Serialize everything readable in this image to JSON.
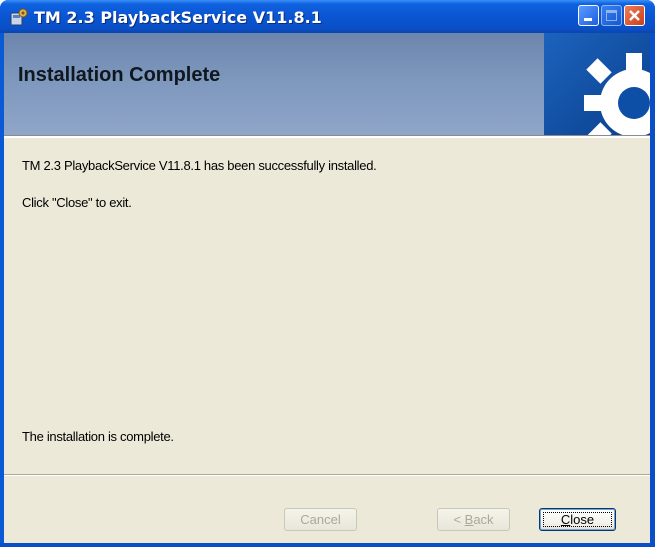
{
  "window": {
    "title": "TM 2.3 PlaybackService V11.8.1",
    "icon": "installer-icon",
    "controls": [
      "minimize-icon",
      "maximize-icon",
      "close-icon"
    ]
  },
  "banner": {
    "title": "Installation Complete",
    "art_icon": "gear-icon"
  },
  "body": {
    "line1": "TM 2.3 PlaybackService V11.8.1 has been successfully installed.",
    "line2": "Click \"Close\" to exit.",
    "status": "The installation is complete."
  },
  "buttons": {
    "cancel": "Cancel",
    "back": "Back",
    "back_mnemonic": "B",
    "back_rest": "ack",
    "back_prefix": "< ",
    "close": "Close",
    "close_mnemonic": "C",
    "close_rest": "lose",
    "cancel_enabled": false,
    "back_enabled": false,
    "close_enabled": true
  },
  "colors": {
    "titlebar": "#0a55d2",
    "banner": "#7e97bd",
    "client": "#ece9d8",
    "disabled_text": "#aca899"
  }
}
